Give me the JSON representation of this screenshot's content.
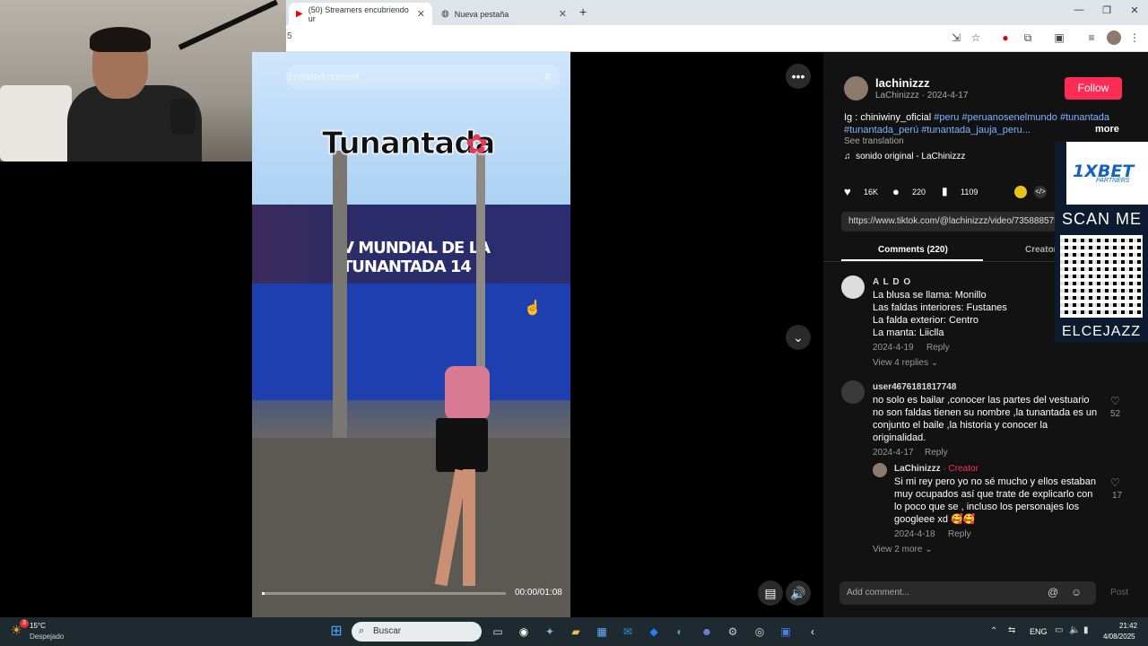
{
  "browser": {
    "tabs": [
      {
        "label": "(50) Streamers encubriendo ur",
        "icon": "youtube-icon"
      },
      {
        "label": "Nueva pestaña",
        "icon": "globe-icon"
      }
    ],
    "address_fragment": "5"
  },
  "video": {
    "title": "Tunantada",
    "search_placeholder": "d related content",
    "banner_text": "V MUNDIAL DE LA TUNANTADA 14",
    "time": "00:00/01:08",
    "progress": 0.01
  },
  "post": {
    "username": "lachinizzz",
    "byline": "LaChinizzz · 2024-4-17",
    "follow_label": "Follow",
    "caption_prefix": "Ig : chiniwiny_oficial ",
    "hashtags_line1": "#peru #peruanosenelmundo #tunantada",
    "hashtags_line2": "#tunantada_perú #tunantada_jauja_peru...",
    "more_label": "more",
    "see_translation": "See translation",
    "sound": "sonido original - LaChinizzz",
    "likes": "16K",
    "comments": "220",
    "saves": "1109",
    "url": "https://www.tiktok.com/@lachinizzz/video/735888575",
    "tabs": [
      "Comments (220)",
      "Creator"
    ]
  },
  "comments": [
    {
      "name": "A L D O",
      "lines": [
        "La blusa se llama: Monillo",
        "Las faldas interiores: Fustanes",
        "La falda exterior: Centro",
        "La manta: Liiclla"
      ],
      "date": "2024-4-19",
      "reply": "Reply",
      "view_replies": "View 4 replies"
    },
    {
      "name": "user4676181817748",
      "lines": [
        "no solo es bailar ,conocer las partes del vestuario",
        "no son faldas tienen su nombre ,la tunantada es un",
        "conjunto el baile ,la historia y conocer la",
        "originalidad."
      ],
      "date": "2024-4-17",
      "reply": "Reply",
      "likes": "52"
    }
  ],
  "reply": {
    "name": "LaChinizzz",
    "creator_tag": " · Creator",
    "lines": [
      "Si mi rey pero yo no sé mucho y ellos estaban",
      "muy ocupados así que trate de explicarlo con",
      "lo poco que se , incluso los personajes los",
      "googleee xd 🥰🥰"
    ],
    "date": "2024-4-18",
    "reply": "Reply",
    "likes": "17",
    "view_more": "View 2 more"
  },
  "composer": {
    "placeholder": "Add comment...",
    "post_label": "Post"
  },
  "ad": {
    "brand": "1XBET",
    "tag": "PARTNERS",
    "scan": "SCAN ME",
    "code": "ELCEJAZZ"
  },
  "taskbar": {
    "temp": "15°C",
    "weather": "Despejado",
    "search": "Buscar",
    "lang": "ENG",
    "time": "21:42",
    "date": "4/08/2025",
    "badge": "3"
  },
  "colors": {
    "accent": "#fe2c55",
    "hashtag": "#7fb3ff",
    "panel": "#121212"
  }
}
